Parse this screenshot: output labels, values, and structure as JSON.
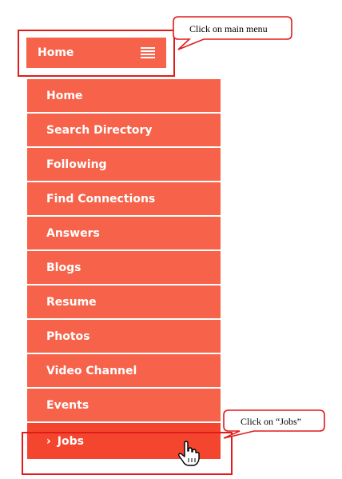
{
  "menu_button": {
    "label": "Home",
    "icon": "hamburger-icon"
  },
  "callouts": {
    "main_menu": "Click on main menu",
    "jobs": "Click on “Jobs”"
  },
  "dropdown": {
    "items": [
      {
        "label": "Home"
      },
      {
        "label": "Search Directory"
      },
      {
        "label": "Following"
      },
      {
        "label": "Find Connections"
      },
      {
        "label": "Answers"
      },
      {
        "label": "Blogs"
      },
      {
        "label": "Resume"
      },
      {
        "label": "Photos"
      },
      {
        "label": "Video Channel"
      },
      {
        "label": "Events"
      }
    ],
    "active_item": {
      "label": "Jobs",
      "prefix_icon": "chevron-right-icon"
    }
  },
  "colors": {
    "menu_background": "#f6634a",
    "active_background": "#f4452f",
    "annotation_red": "#e01b1b",
    "text": "#ffffff"
  }
}
